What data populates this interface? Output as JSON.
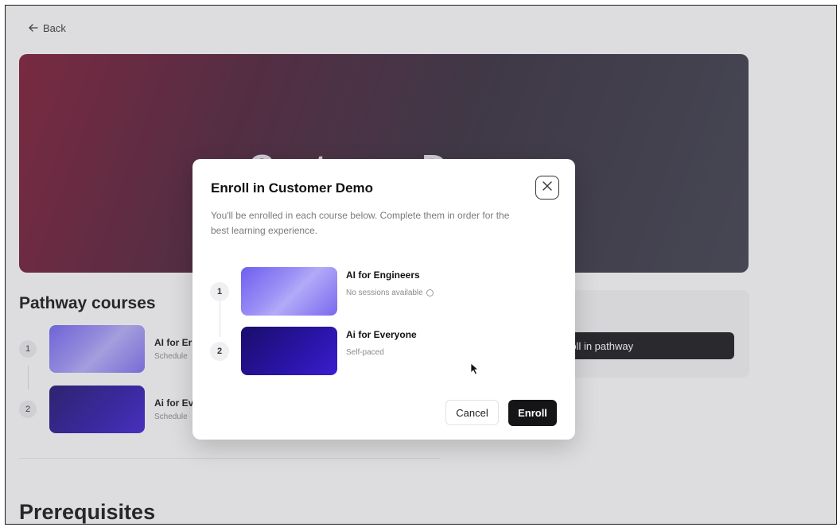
{
  "page": {
    "back_label": "Back",
    "hero_title": "Customer Demo",
    "section_title": "Pathway courses",
    "enroll_pathway_label": "roll in pathway",
    "prerequisites_title": "Prerequisites",
    "courses": [
      {
        "number": "1",
        "title": "AI for Er",
        "subtitle": "Schedule"
      },
      {
        "number": "2",
        "title": "Ai for Ev",
        "subtitle": "Schedule"
      }
    ]
  },
  "modal": {
    "title": "Enroll in Customer Demo",
    "description": "You'll be enrolled in each course below. Complete them in order for the best learning experience.",
    "courses": [
      {
        "number": "1",
        "title": "AI for Engineers",
        "subtitle": "No sessions available",
        "thumb_style": "light"
      },
      {
        "number": "2",
        "title": "Ai for Everyone",
        "subtitle": "Self-paced",
        "thumb_style": "dark"
      }
    ],
    "cancel_label": "Cancel",
    "enroll_label": "Enroll"
  },
  "colors": {
    "primary_button": "#151518",
    "hero_start": "#7a1530",
    "hero_end": "#3a3a48",
    "thumb_light": "#8c80f3",
    "thumb_dark": "#2a14a8"
  },
  "icons": {
    "back": "arrow-left-icon",
    "close": "close-icon",
    "info": "info-icon",
    "cursor": "mouse-pointer-icon"
  }
}
